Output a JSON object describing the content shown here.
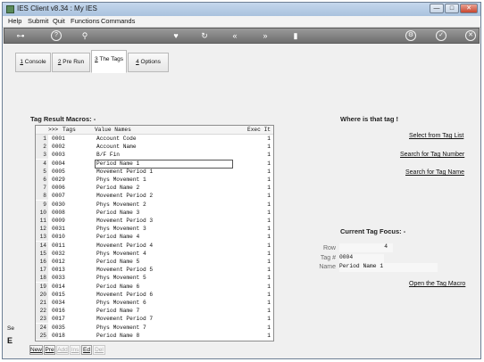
{
  "window": {
    "title": "IES Client v8.34 : My IES",
    "min": "—",
    "max": "□",
    "close": "✕"
  },
  "menu": [
    "Help",
    "Submit",
    "Quit",
    "Functions",
    "Commands"
  ],
  "toolbar": {
    "icons": [
      {
        "name": "key-icon",
        "glyph": "⊶"
      },
      {
        "name": "help-icon",
        "glyph": "?"
      },
      {
        "name": "search-icon",
        "glyph": "⚲"
      },
      {
        "name": "heart-icon",
        "glyph": "♥"
      },
      {
        "name": "refresh-icon",
        "glyph": "↻"
      },
      {
        "name": "back-icon",
        "glyph": "«"
      },
      {
        "name": "forward-icon",
        "glyph": "»"
      },
      {
        "name": "stop-icon",
        "glyph": "▮"
      },
      {
        "name": "settings-icon",
        "glyph": "⚙"
      },
      {
        "name": "ok-icon",
        "glyph": "✓"
      },
      {
        "name": "close-icon",
        "glyph": "✕"
      }
    ]
  },
  "tabs": [
    {
      "key": "1",
      "label": "Console"
    },
    {
      "key": "2",
      "label": "Pre Run"
    },
    {
      "key": "3",
      "label": "The Tags"
    },
    {
      "key": "4",
      "label": "Options"
    }
  ],
  "left_panel": {
    "title": "Tag Result Macros: -",
    "columns": {
      "arrow": ">>>",
      "tags": "Tags",
      "value_names": "Value Names",
      "exec": "Exec It"
    },
    "rows": [
      {
        "n": "1",
        "tag": "0001",
        "name": "Account Code",
        "exec": "1"
      },
      {
        "n": "2",
        "tag": "0002",
        "name": "Account Name",
        "exec": "1"
      },
      {
        "n": "3",
        "tag": "0003",
        "name": "B/F Fin",
        "exec": "1"
      },
      {
        "n": "4",
        "tag": "0004",
        "name": "Period Name 1",
        "exec": "1"
      },
      {
        "n": "5",
        "tag": "0005",
        "name": "Movement Period 1",
        "exec": "1"
      },
      {
        "n": "6",
        "tag": "0029",
        "name": "Phys Movement 1",
        "exec": "1"
      },
      {
        "n": "7",
        "tag": "0006",
        "name": "Period Name 2",
        "exec": "1"
      },
      {
        "n": "8",
        "tag": "0007",
        "name": "Movement Period 2",
        "exec": "1"
      },
      {
        "n": "9",
        "tag": "0030",
        "name": "Phys Movement 2",
        "exec": "1"
      },
      {
        "n": "10",
        "tag": "0008",
        "name": "Period Name 3",
        "exec": "1"
      },
      {
        "n": "11",
        "tag": "0009",
        "name": "Movement Period 3",
        "exec": "1"
      },
      {
        "n": "12",
        "tag": "0031",
        "name": "Phys Movement 3",
        "exec": "1"
      },
      {
        "n": "13",
        "tag": "0010",
        "name": "Period Name 4",
        "exec": "1"
      },
      {
        "n": "14",
        "tag": "0011",
        "name": "Movement Period 4",
        "exec": "1"
      },
      {
        "n": "15",
        "tag": "0032",
        "name": "Phys Movement 4",
        "exec": "1"
      },
      {
        "n": "16",
        "tag": "0012",
        "name": "Period Name 5",
        "exec": "1"
      },
      {
        "n": "17",
        "tag": "0013",
        "name": "Movement Period 5",
        "exec": "1"
      },
      {
        "n": "18",
        "tag": "0033",
        "name": "Phys Movement 5",
        "exec": "1"
      },
      {
        "n": "19",
        "tag": "0014",
        "name": "Period Name 6",
        "exec": "1"
      },
      {
        "n": "20",
        "tag": "0015",
        "name": "Movement Period 6",
        "exec": "1"
      },
      {
        "n": "21",
        "tag": "0034",
        "name": "Phys Movement 6",
        "exec": "1"
      },
      {
        "n": "22",
        "tag": "0016",
        "name": "Period Name 7",
        "exec": "1"
      },
      {
        "n": "23",
        "tag": "0017",
        "name": "Movement Period 7",
        "exec": "1"
      },
      {
        "n": "24",
        "tag": "0035",
        "name": "Phys Movement 7",
        "exec": "1"
      },
      {
        "n": "25",
        "tag": "0018",
        "name": "Period Name 8",
        "exec": "1"
      }
    ],
    "selected_row": 4,
    "buttons": [
      {
        "label": "New",
        "enabled": true
      },
      {
        "label": "Pre",
        "enabled": true
      },
      {
        "label": "Add",
        "enabled": false
      },
      {
        "label": "Ins",
        "enabled": false
      },
      {
        "label": "Ed",
        "enabled": true
      },
      {
        "label": "Del",
        "enabled": false
      }
    ],
    "side_stub": "Se",
    "side_stub_icon": "E"
  },
  "right_panel": {
    "where_title": "Where is that tag !",
    "links": {
      "select_from_tag_list": "Select from Tag List",
      "search_for_tag_number": "Search for Tag Number",
      "search_for_tag_name": "Search for Tag Name",
      "open_tag_macro": "Open the Tag Macro"
    },
    "focus_title": "Current Tag Focus: -",
    "focus": {
      "row_label": "Row",
      "row_value": "4",
      "tag_label": "Tag #",
      "tag_value": "0004",
      "name_label": "Name",
      "name_value": "Period Name 1"
    }
  }
}
